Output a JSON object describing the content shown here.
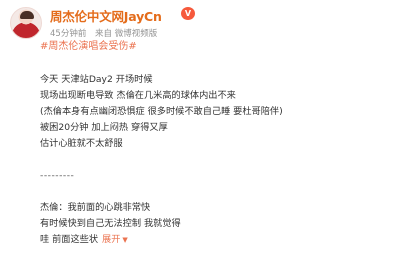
{
  "post": {
    "author": {
      "name": "周杰伦中文网JayCn",
      "badge": "V"
    },
    "time": "45分钟前",
    "source": "来自 微博视频版",
    "topic": "#周杰伦演唱会受伤#",
    "lines": [
      "今天 天津站Day2 开场时候",
      "现场出现断电导致 杰倫在几米高的球体内出不来",
      "(杰倫本身有点幽闭恐惧症 很多时候不敢自己睡 要杜哥陪伴)",
      "被困20分钟 加上闷热 穿得又厚",
      "估计心脏就不太舒服"
    ],
    "divider": "---------",
    "quote_lines": [
      "杰倫：我前面的心跳非常快",
      "有时候快到自己无法控制 我就觉得",
      "哇 前面这些状"
    ],
    "expand_label": "展开",
    "colors": {
      "username": "#e46c1b",
      "link": "#eb7350",
      "badge": "#f6593c",
      "meta": "#939393"
    }
  }
}
